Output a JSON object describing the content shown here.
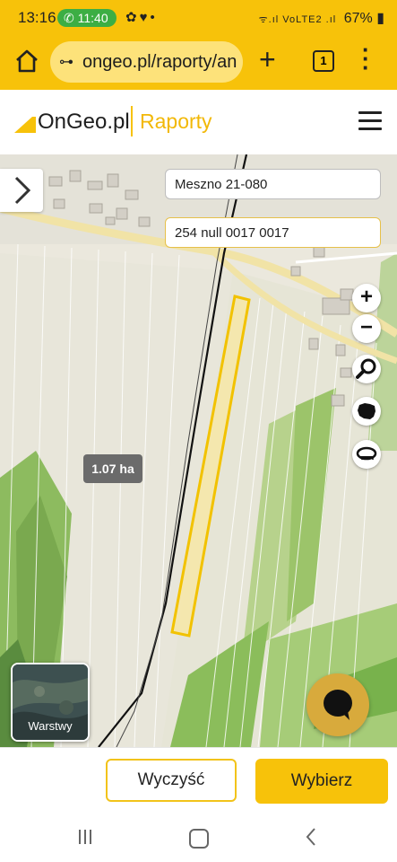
{
  "status_bar": {
    "time": "13:16",
    "call_timer": "11:40",
    "battery": "67%",
    "network_label": "VoLTE2"
  },
  "browser": {
    "url": "ongeo.pl/raporty/an",
    "tab_count": "1"
  },
  "site": {
    "logo_text": "OnGeo.pl",
    "section_label": "Raporty"
  },
  "map": {
    "location_field": "Meszno 21-080",
    "parcel_field": "254 null 0017 0017",
    "area_label": "1.07 ha",
    "layers_label": "Warstwy",
    "zoom_in_glyph": "+",
    "zoom_out_glyph": "−"
  },
  "footer": {
    "clear_label": "Wyczyść",
    "select_label": "Wybierz"
  },
  "colors": {
    "brand_yellow": "#f7c20a",
    "parcel_outline": "#f2c200",
    "chat_button": "#d8aa3c"
  },
  "icons": [
    "home-icon",
    "site-settings-icon",
    "plus-icon",
    "tabs-icon",
    "more-icon",
    "hamburger-icon",
    "chevron-right-icon",
    "zoom-in-icon",
    "zoom-out-icon",
    "search-icon",
    "poland-map-icon",
    "tape-measure-icon",
    "chat-icon"
  ]
}
